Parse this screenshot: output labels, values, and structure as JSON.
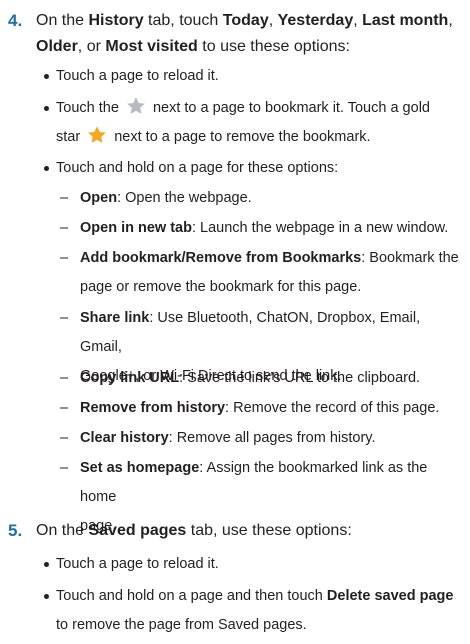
{
  "step4": {
    "number": "4.",
    "t1": "On the ",
    "history_tab": "History",
    "t2": " tab, touch ",
    "today": "Today",
    "c1": ", ",
    "yesterday": "Yesterday",
    "c2": ", ",
    "last_month": "Last month",
    "c3": ",",
    "older": "Older",
    "t3": ", or ",
    "most_visited": "Most visited",
    "t4": " to use these options:",
    "bullets": [
      "Touch a page to reload it.",
      {
        "a": "Touch the",
        "b": "next to a page to bookmark it. Touch a gold",
        "c": "star",
        "d": "next to a page to remove the bookmark."
      },
      "Touch and hold on a page for these options:"
    ],
    "options": [
      {
        "label": "Open",
        "desc": ": Open the webpage."
      },
      {
        "label": "Open in new tab",
        "desc": ": Launch the webpage in a new window."
      },
      {
        "label": "Add bookmark/Remove from Bookmarks",
        "desc": ": Bookmark the",
        "desc2": "page or remove the bookmark for this page."
      },
      {
        "label": "Share link",
        "desc": ": Use Bluetooth, ChatON, Dropbox, Email, Gmail,",
        "desc2": "Google+, or Wi-Fi Direct to send the link."
      },
      {
        "label": "Copy link URL",
        "desc": ": Save the link’s URL to the clipboard."
      },
      {
        "label": "Remove from history",
        "desc": ": Remove the record of this page."
      },
      {
        "label": "Clear history",
        "desc": ": Remove all pages from history."
      },
      {
        "label": "Set as homepage",
        "desc": ": Assign the bookmarked link as the home",
        "desc2": "page."
      }
    ]
  },
  "step5": {
    "number": "5.",
    "t1": "On the ",
    "saved_tab": "Saved pages",
    "t2": " tab, use these options:",
    "bullets": [
      "Touch a page to reload it.",
      {
        "a": "Touch and hold on a page and then touch ",
        "delete": "Delete saved page",
        "b": "to remove the page from Saved pages."
      }
    ]
  },
  "icons": {
    "grey_star": "star-outline-icon",
    "gold_star": "star-filled-icon",
    "grey_star_color": "#b8bcc2",
    "gold_star_color": "#f5a623"
  },
  "colors": {
    "step_number": "#1b6fa3",
    "text": "#231f20"
  }
}
